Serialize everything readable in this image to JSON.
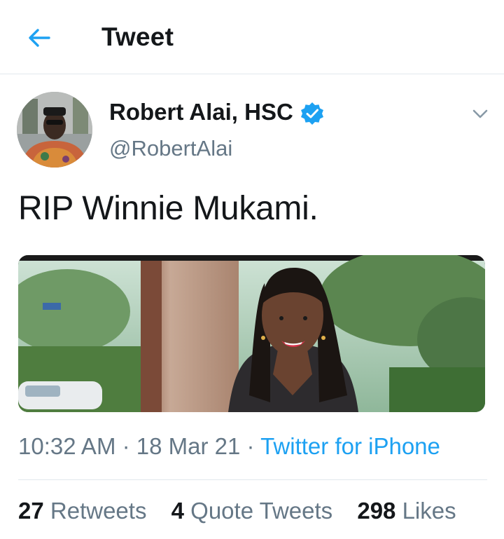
{
  "header": {
    "title": "Tweet",
    "back_icon": "arrow-left-icon"
  },
  "author": {
    "name": "Robert Alai, HSC",
    "handle": "@RobertAlai",
    "verified": true,
    "avatar_icon": "avatar-photo"
  },
  "tweet": {
    "text": "RIP Winnie Mukami.",
    "media_icon": "photo-woman-smiling"
  },
  "meta": {
    "time": "10:32 AM",
    "sep1": " · ",
    "date": "18 Mar 21",
    "sep2": " · ",
    "source": "Twitter for iPhone"
  },
  "stats": {
    "retweets_count": "27",
    "retweets_label": "Retweets",
    "quotes_count": "4",
    "quotes_label": "Quote Tweets",
    "likes_count": "298",
    "likes_label": "Likes"
  },
  "colors": {
    "accent": "#1da1f2",
    "muted": "#657786",
    "text": "#14171a",
    "divider": "#e1e8ed"
  }
}
